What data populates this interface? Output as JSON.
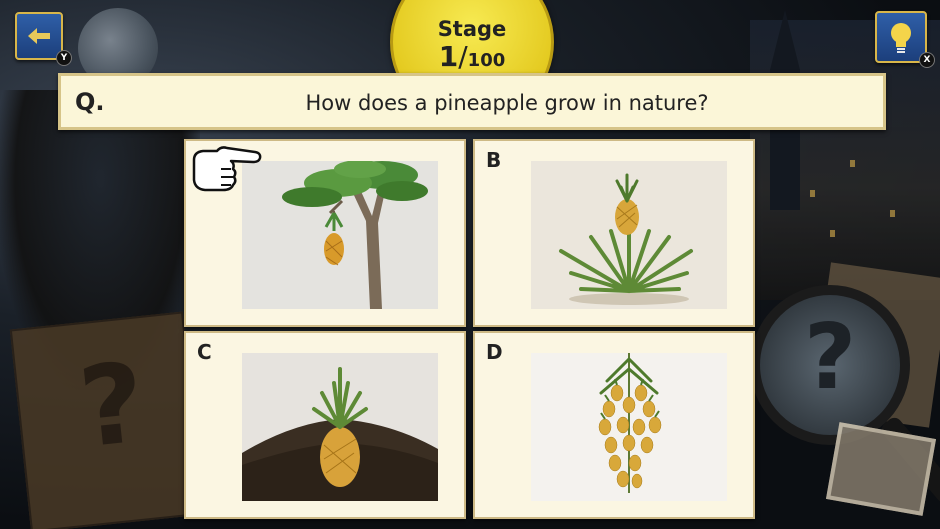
{
  "stage": {
    "title": "Stage",
    "current": "1",
    "separator": "/",
    "total": "100"
  },
  "question": {
    "label": "Q.",
    "text": "How does a pineapple grow in nature?"
  },
  "buttons": {
    "back_key": "Y",
    "hint_key": "X"
  },
  "options": [
    {
      "letter": "",
      "image": "pineapple-hanging-from-tree"
    },
    {
      "letter": "B",
      "image": "pineapple-on-leafy-plant"
    },
    {
      "letter": "C",
      "image": "pineapple-in-soil"
    },
    {
      "letter": "D",
      "image": "pineapple-bunch-hanging"
    }
  ],
  "colors": {
    "stage_yellow": "#f2df3a",
    "button_blue": "#2f5fa8",
    "card_bg": "#fbf6e2",
    "accent_gold": "#d8b64a"
  }
}
